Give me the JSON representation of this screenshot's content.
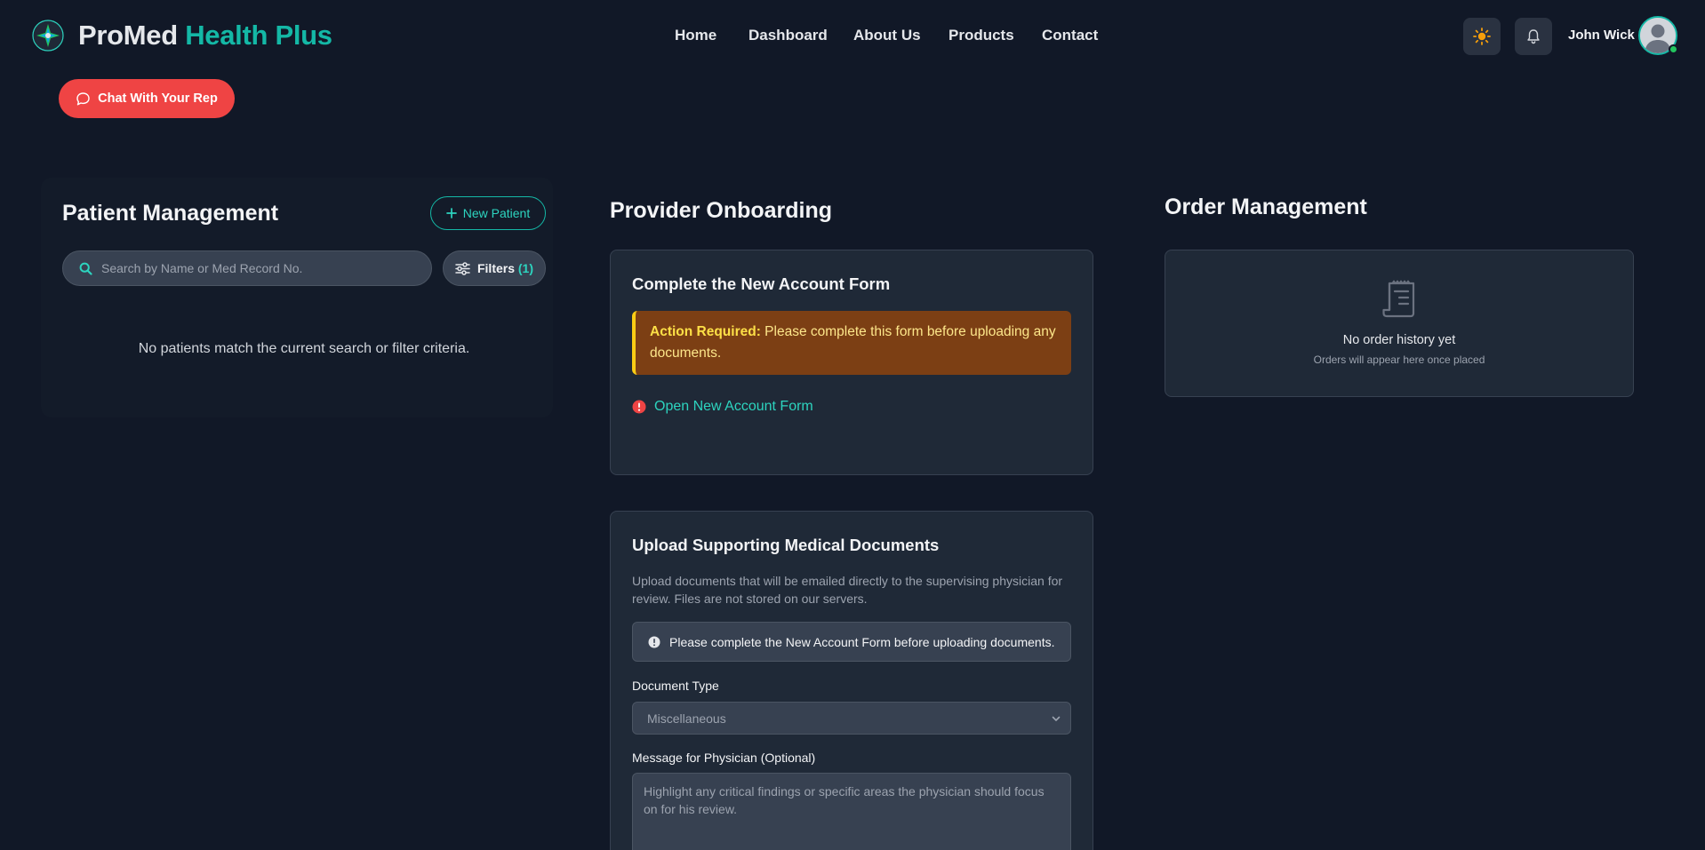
{
  "header": {
    "brand_part1": "ProMed",
    "brand_part2": "Health Plus",
    "nav": [
      "Home",
      "Dashboard",
      "About Us",
      "Products",
      "Contact"
    ],
    "theme_icon": "sun-icon",
    "notification_icon": "bell-icon",
    "user_name": "John Wick",
    "user_status": "online"
  },
  "chat": {
    "label": "Chat With Your Rep",
    "icon": "chat-bubble-icon"
  },
  "patients": {
    "title": "Patient Management",
    "new_button": "New Patient",
    "search_placeholder": "Search by Name or Med Record No.",
    "filters_label": "Filters",
    "filters_count": "(1)",
    "empty_message": "No patients match the current search or filter criteria."
  },
  "onboarding": {
    "title": "Provider Onboarding",
    "form_card": {
      "title": "Complete the New Account Form",
      "alert_strong": "Action Required:",
      "alert_text": " Please complete this form before uploading any documents.",
      "link": "Open New Account Form"
    },
    "upload_card": {
      "title": "Upload Supporting Medical Documents",
      "description": "Upload documents that will be emailed directly to the supervising physician for review. Files are not stored on our servers.",
      "info": "Please complete the New Account Form before uploading documents.",
      "doc_type_label": "Document Type",
      "doc_type_value": "Miscellaneous",
      "message_label": "Message for Physician (Optional)",
      "message_placeholder": "Highlight any critical findings or specific areas the physician should focus on for his review."
    }
  },
  "orders": {
    "title": "Order Management",
    "empty_title": "No order history yet",
    "empty_subtitle": "Orders will appear here once placed"
  },
  "colors": {
    "background": "#111827",
    "card": "#1f2937",
    "accent": "#14b8a6",
    "danger": "#ef4444",
    "warning_bg": "#7c3f14",
    "warning_border": "#facc15"
  }
}
